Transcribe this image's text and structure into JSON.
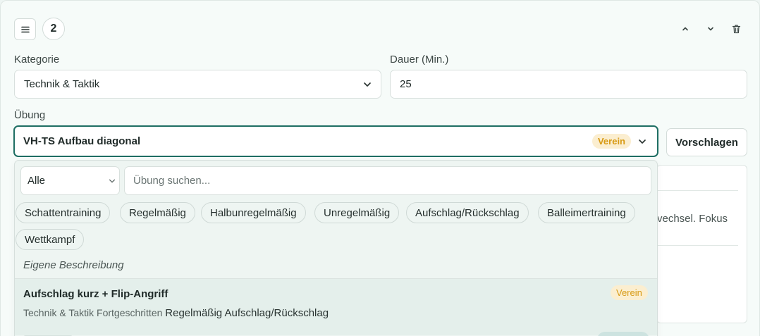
{
  "header": {
    "handle_icon": "menu-icon",
    "step_number": "2",
    "icons": [
      "chevron-up-icon",
      "chevron-down-icon",
      "trash-icon"
    ]
  },
  "fields": {
    "category_label": "Kategorie",
    "category_value": "Technik & Taktik",
    "duration_label": "Dauer (Min.)",
    "duration_value": "25",
    "exercise_label": "Übung",
    "exercise_value": "VH-TS Aufbau diagonal",
    "exercise_badge": "Verein",
    "propose_button": "Vorschlagen"
  },
  "behind_panel": {
    "text": "vechsel. Fokus"
  },
  "dropdown": {
    "filter_value": "Alle",
    "search_placeholder": "Übung suchen...",
    "chips": [
      "Schattentraining",
      "Regelmäßig",
      "Halbunregelmäßig",
      "Unregelmäßig",
      "Aufschlag/Rückschlag",
      "Balleimertraining",
      "Wettkampf"
    ],
    "custom_description": "Eigene Beschreibung",
    "items": [
      {
        "title": "Aufschlag kurz + Flip-Angriff",
        "badge": "Verein",
        "meta": "Technik & Taktik",
        "level": "Fortgeschritten",
        "tags": "Regelmäßig Aufschlag/Rückschlag"
      }
    ]
  },
  "colors": {
    "accent": "#1e6e63",
    "badge_bg": "#fbeed0",
    "badge_text": "#d79a14",
    "background": "#f6fbf9"
  }
}
